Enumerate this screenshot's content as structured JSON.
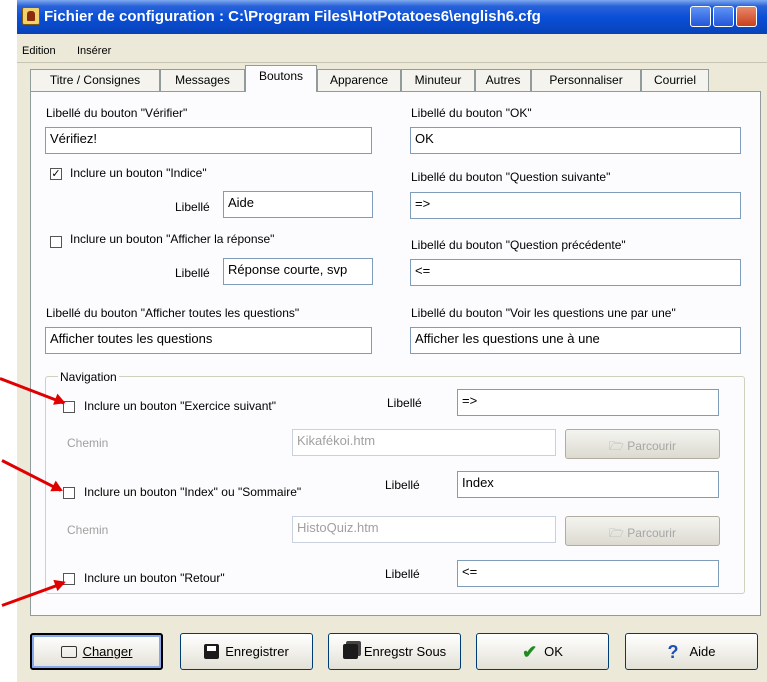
{
  "window": {
    "title": "Fichier de configuration : C:\\Program Files\\HotPotatoes6\\english6.cfg"
  },
  "menu": {
    "items": [
      "Edition",
      "Insérer"
    ]
  },
  "tabs": [
    {
      "label": "Titre / Consignes",
      "active": false
    },
    {
      "label": "Messages",
      "active": false
    },
    {
      "label": "Boutons",
      "active": true
    },
    {
      "label": "Apparence",
      "active": false
    },
    {
      "label": "Minuteur",
      "active": false
    },
    {
      "label": "Autres",
      "active": false
    },
    {
      "label": "Personnaliser",
      "active": false
    },
    {
      "label": "Courriel",
      "active": false
    }
  ],
  "form": {
    "verifier_label": "Libellé du bouton \"Vérifier\"",
    "verifier_value": "Vérifiez!",
    "ok_label": "Libellé du bouton \"OK\"",
    "ok_value": "OK",
    "indice_checkbox": "Inclure un bouton \"Indice\"",
    "indice_checked": true,
    "libelle": "Libellé",
    "indice_value": "Aide",
    "suivante_label": "Libellé du bouton \"Question suivante\"",
    "suivante_value": "=>",
    "reponse_checkbox": "Inclure un bouton \"Afficher la réponse\"",
    "reponse_checked": false,
    "reponse_value": "Réponse courte, svp",
    "precedente_label": "Libellé du bouton \"Question précédente\"",
    "precedente_value": "<=",
    "toutes_label": "Libellé du bouton \"Afficher toutes les questions\"",
    "toutes_value": "Afficher toutes les questions",
    "une_par_une_label": "Libellé du bouton \"Voir les questions une par une\"",
    "une_par_une_value": "Afficher les questions une à une"
  },
  "navigation": {
    "title": "Navigation",
    "chemin": "Chemin",
    "parcourir": "Parcourir",
    "suivant_checkbox": "Inclure un bouton \"Exercice suivant\"",
    "suivant_value": "=>",
    "suivant_path": "Kikafékoi.htm",
    "index_checkbox": "Inclure un bouton \"Index\" ou \"Sommaire\"",
    "index_value": "Index",
    "index_path": "HistoQuiz.htm",
    "retour_checkbox": "Inclure un bouton \"Retour\"",
    "retour_value": "<="
  },
  "buttons": {
    "changer": "Changer",
    "enregistrer": "Enregistrer",
    "enregistrer_sous": "Enregstr Sous",
    "ok": "OK",
    "aide": "Aide"
  },
  "colors": {
    "annotation_arrow": "#e00000",
    "title_bar": "#0a4fd8"
  }
}
